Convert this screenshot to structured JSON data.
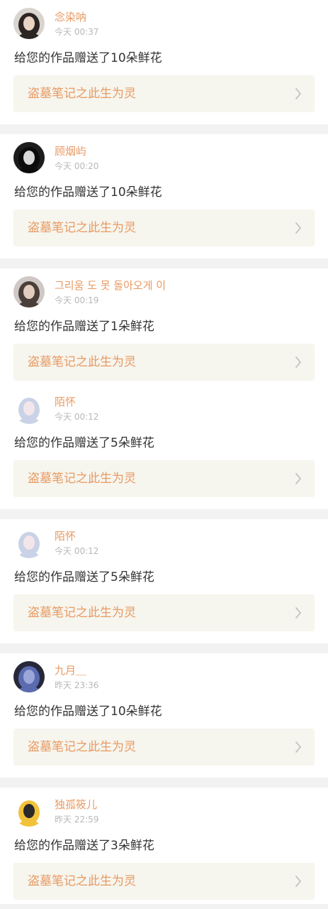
{
  "colors": {
    "accent": "#e89a63",
    "message_text": "#333333",
    "time_text": "#b8b8b8",
    "work_card_bg": "#f6f5ee",
    "page_bg": "#f2f2f2"
  },
  "notifications": [
    {
      "user_name": "念染呐",
      "time": "今天 00:37",
      "message": "给您的作品赠送了10朵鲜花",
      "work_title": "盗墓笔记之此生为灵",
      "avatar": {
        "icon": "avatar-dark-hair",
        "bg": "#d9d4d0",
        "fg": "#2a2422",
        "skin": "#e8d3c4"
      },
      "gap_after": true
    },
    {
      "user_name": "顾烟屿",
      "time": "今天 00:20",
      "message": "给您的作品赠送了10朵鲜花",
      "work_title": "盗墓笔记之此生为灵",
      "avatar": {
        "icon": "avatar-black-white",
        "bg": "#1c1c1c",
        "fg": "#0b0b0b",
        "skin": "#d8d8d8"
      },
      "gap_after": true
    },
    {
      "user_name": "그리움 도 못 돌아오게 이",
      "time": "今天 00:19",
      "message": "给您的作品赠送了1朵鲜花",
      "work_title": "盗墓笔记之此生为灵",
      "avatar": {
        "icon": "avatar-portrait",
        "bg": "#cfc8c4",
        "fg": "#4a3e3a",
        "skin": "#e3cbbd"
      },
      "gap_after": false
    },
    {
      "user_name": "陌怀",
      "time": "今天 00:12",
      "message": "给您的作品赠送了5朵鲜花",
      "work_title": "盗墓笔记之此生为灵",
      "avatar": {
        "icon": "avatar-anime-white-hair",
        "bg": "#ffffff",
        "fg": "#c9d2e6",
        "skin": "#f3e6ea"
      },
      "gap_after": true
    },
    {
      "user_name": "陌怀",
      "time": "今天 00:12",
      "message": "给您的作品赠送了5朵鲜花",
      "work_title": "盗墓笔记之此生为灵",
      "avatar": {
        "icon": "avatar-anime-white-hair",
        "bg": "#ffffff",
        "fg": "#c9d2e6",
        "skin": "#f3e6ea"
      },
      "gap_after": true
    },
    {
      "user_name": "九月＿",
      "time": "昨天 23:36",
      "message": "给您的作品赠送了10朵鲜花",
      "work_title": "盗墓笔记之此生为灵",
      "avatar": {
        "icon": "avatar-night-scene",
        "bg": "#26283a",
        "fg": "#5a6bb0",
        "skin": "#9aa7d8"
      },
      "gap_after": true
    },
    {
      "user_name": "独孤筱儿",
      "time": "昨天 22:59",
      "message": "给您的作品赠送了3朵鲜花",
      "work_title": "盗墓笔记之此生为灵",
      "avatar": {
        "icon": "avatar-yellow-cartoon",
        "bg": "#ffffff",
        "fg": "#f2c23a",
        "skin": "#2a2a2a"
      },
      "gap_after": false
    }
  ]
}
